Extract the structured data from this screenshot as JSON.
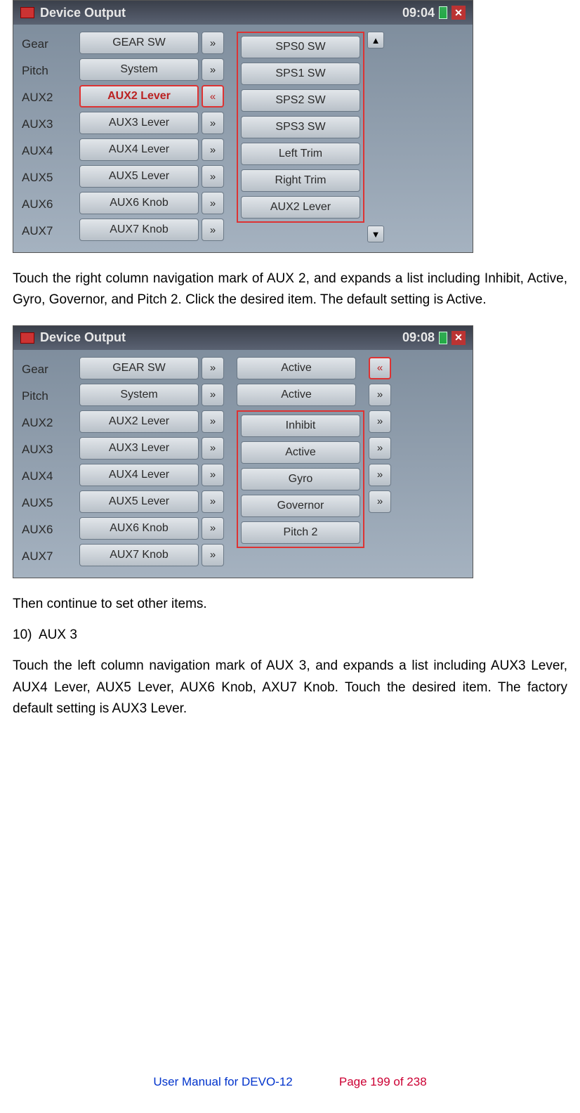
{
  "screenshot1": {
    "title": "Device Output",
    "time": "09:04",
    "labels": [
      "Gear",
      "Pitch",
      "AUX2",
      "AUX3",
      "AUX4",
      "AUX5",
      "AUX6",
      "AUX7"
    ],
    "mid": [
      {
        "text": "GEAR SW",
        "chev": "»",
        "selected": false
      },
      {
        "text": "System",
        "chev": "»",
        "selected": false
      },
      {
        "text": "AUX2 Lever",
        "chev": "«",
        "selected": true
      },
      {
        "text": "AUX3 Lever",
        "chev": "»",
        "selected": false
      },
      {
        "text": "AUX4 Lever",
        "chev": "»",
        "selected": false
      },
      {
        "text": "AUX5 Lever",
        "chev": "»",
        "selected": false
      },
      {
        "text": "AUX6 Knob",
        "chev": "»",
        "selected": false
      },
      {
        "text": "AUX7 Knob",
        "chev": "»",
        "selected": false
      }
    ],
    "right": [
      "SPS0 SW",
      "SPS1 SW",
      "SPS2 SW",
      "SPS3 SW",
      "Left Trim",
      "Right Trim",
      "AUX2 Lever"
    ]
  },
  "para1": "Touch the right column navigation mark of AUX 2, and expands a list including Inhibit, Active, Gyro, Governor, and Pitch 2. Click the desired item. The default setting is Active.",
  "screenshot2": {
    "title": "Device Output",
    "time": "09:08",
    "labels": [
      "Gear",
      "Pitch",
      "AUX2",
      "AUX3",
      "AUX4",
      "AUX5",
      "AUX6",
      "AUX7"
    ],
    "mid": [
      {
        "text": "GEAR SW",
        "chev": "»"
      },
      {
        "text": "System",
        "chev": "»"
      },
      {
        "text": "AUX2 Lever",
        "chev": "»"
      },
      {
        "text": "AUX3 Lever",
        "chev": "»"
      },
      {
        "text": "AUX4 Lever",
        "chev": "»"
      },
      {
        "text": "AUX5 Lever",
        "chev": "»"
      },
      {
        "text": "AUX6 Knob",
        "chev": "»"
      },
      {
        "text": "AUX7 Knob",
        "chev": "»"
      }
    ],
    "right_top": [
      {
        "text": "Active",
        "chev": "»"
      },
      {
        "text": "Active",
        "chev": "»"
      }
    ],
    "right_list": [
      "Inhibit",
      "Active",
      "Gyro",
      "Governor",
      "Pitch 2"
    ],
    "right_chevs": [
      "«",
      "»",
      "»",
      "»",
      "»",
      "»"
    ]
  },
  "para2": "Then continue to set other items.",
  "heading10": "10)  AUX 3",
  "para3": "Touch the left column navigation mark of AUX 3, and expands a list including AUX3 Lever, AUX4 Lever, AUX5 Lever, AUX6 Knob, AXU7 Knob. Touch the desired item. The factory default setting is AUX3 Lever.",
  "footer": {
    "left": "User Manual for DEVO-12",
    "right": "Page 199 of 238"
  },
  "icons": {
    "up": "▲",
    "down": "▼",
    "close": "✕"
  }
}
